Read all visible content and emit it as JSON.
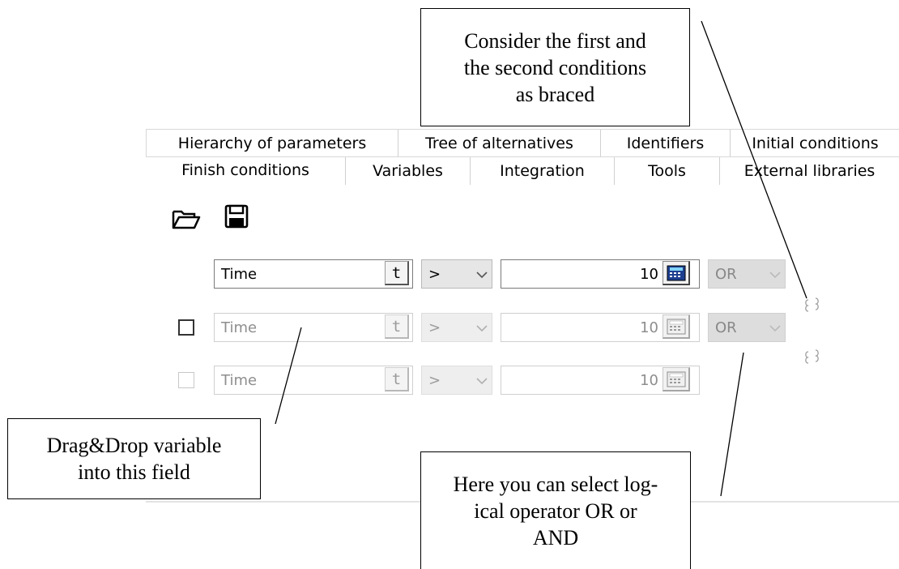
{
  "tabs_back": [
    "Hierarchy of parameters",
    "Tree of alternatives",
    "Identifiers",
    "Initial conditions"
  ],
  "tabs_front": [
    "Finish conditions",
    "Variables",
    "Integration",
    "Tools",
    "External libraries"
  ],
  "toolbar": {
    "open_icon": "folder-open-icon",
    "save_icon": "floppy-disk-icon"
  },
  "conditions": [
    {
      "variable": "Time",
      "t_button": "t",
      "operator": ">",
      "value": "10",
      "logic": "OR",
      "enabled": true
    },
    {
      "variable": "Time",
      "t_button": "t",
      "operator": ">",
      "value": "10",
      "logic": "OR",
      "enabled": false
    },
    {
      "variable": "Time",
      "t_button": "t",
      "operator": ">",
      "value": "10",
      "enabled": false
    }
  ],
  "brace_icon": "brace-link-icon",
  "callouts": {
    "top": [
      "Consider the first and",
      "the second conditions",
      "as braced"
    ],
    "left": [
      "Drag&Drop variable",
      "into this field"
    ],
    "bottom": [
      "Here you can select log-",
      "ical operator OR or",
      "AND"
    ]
  }
}
